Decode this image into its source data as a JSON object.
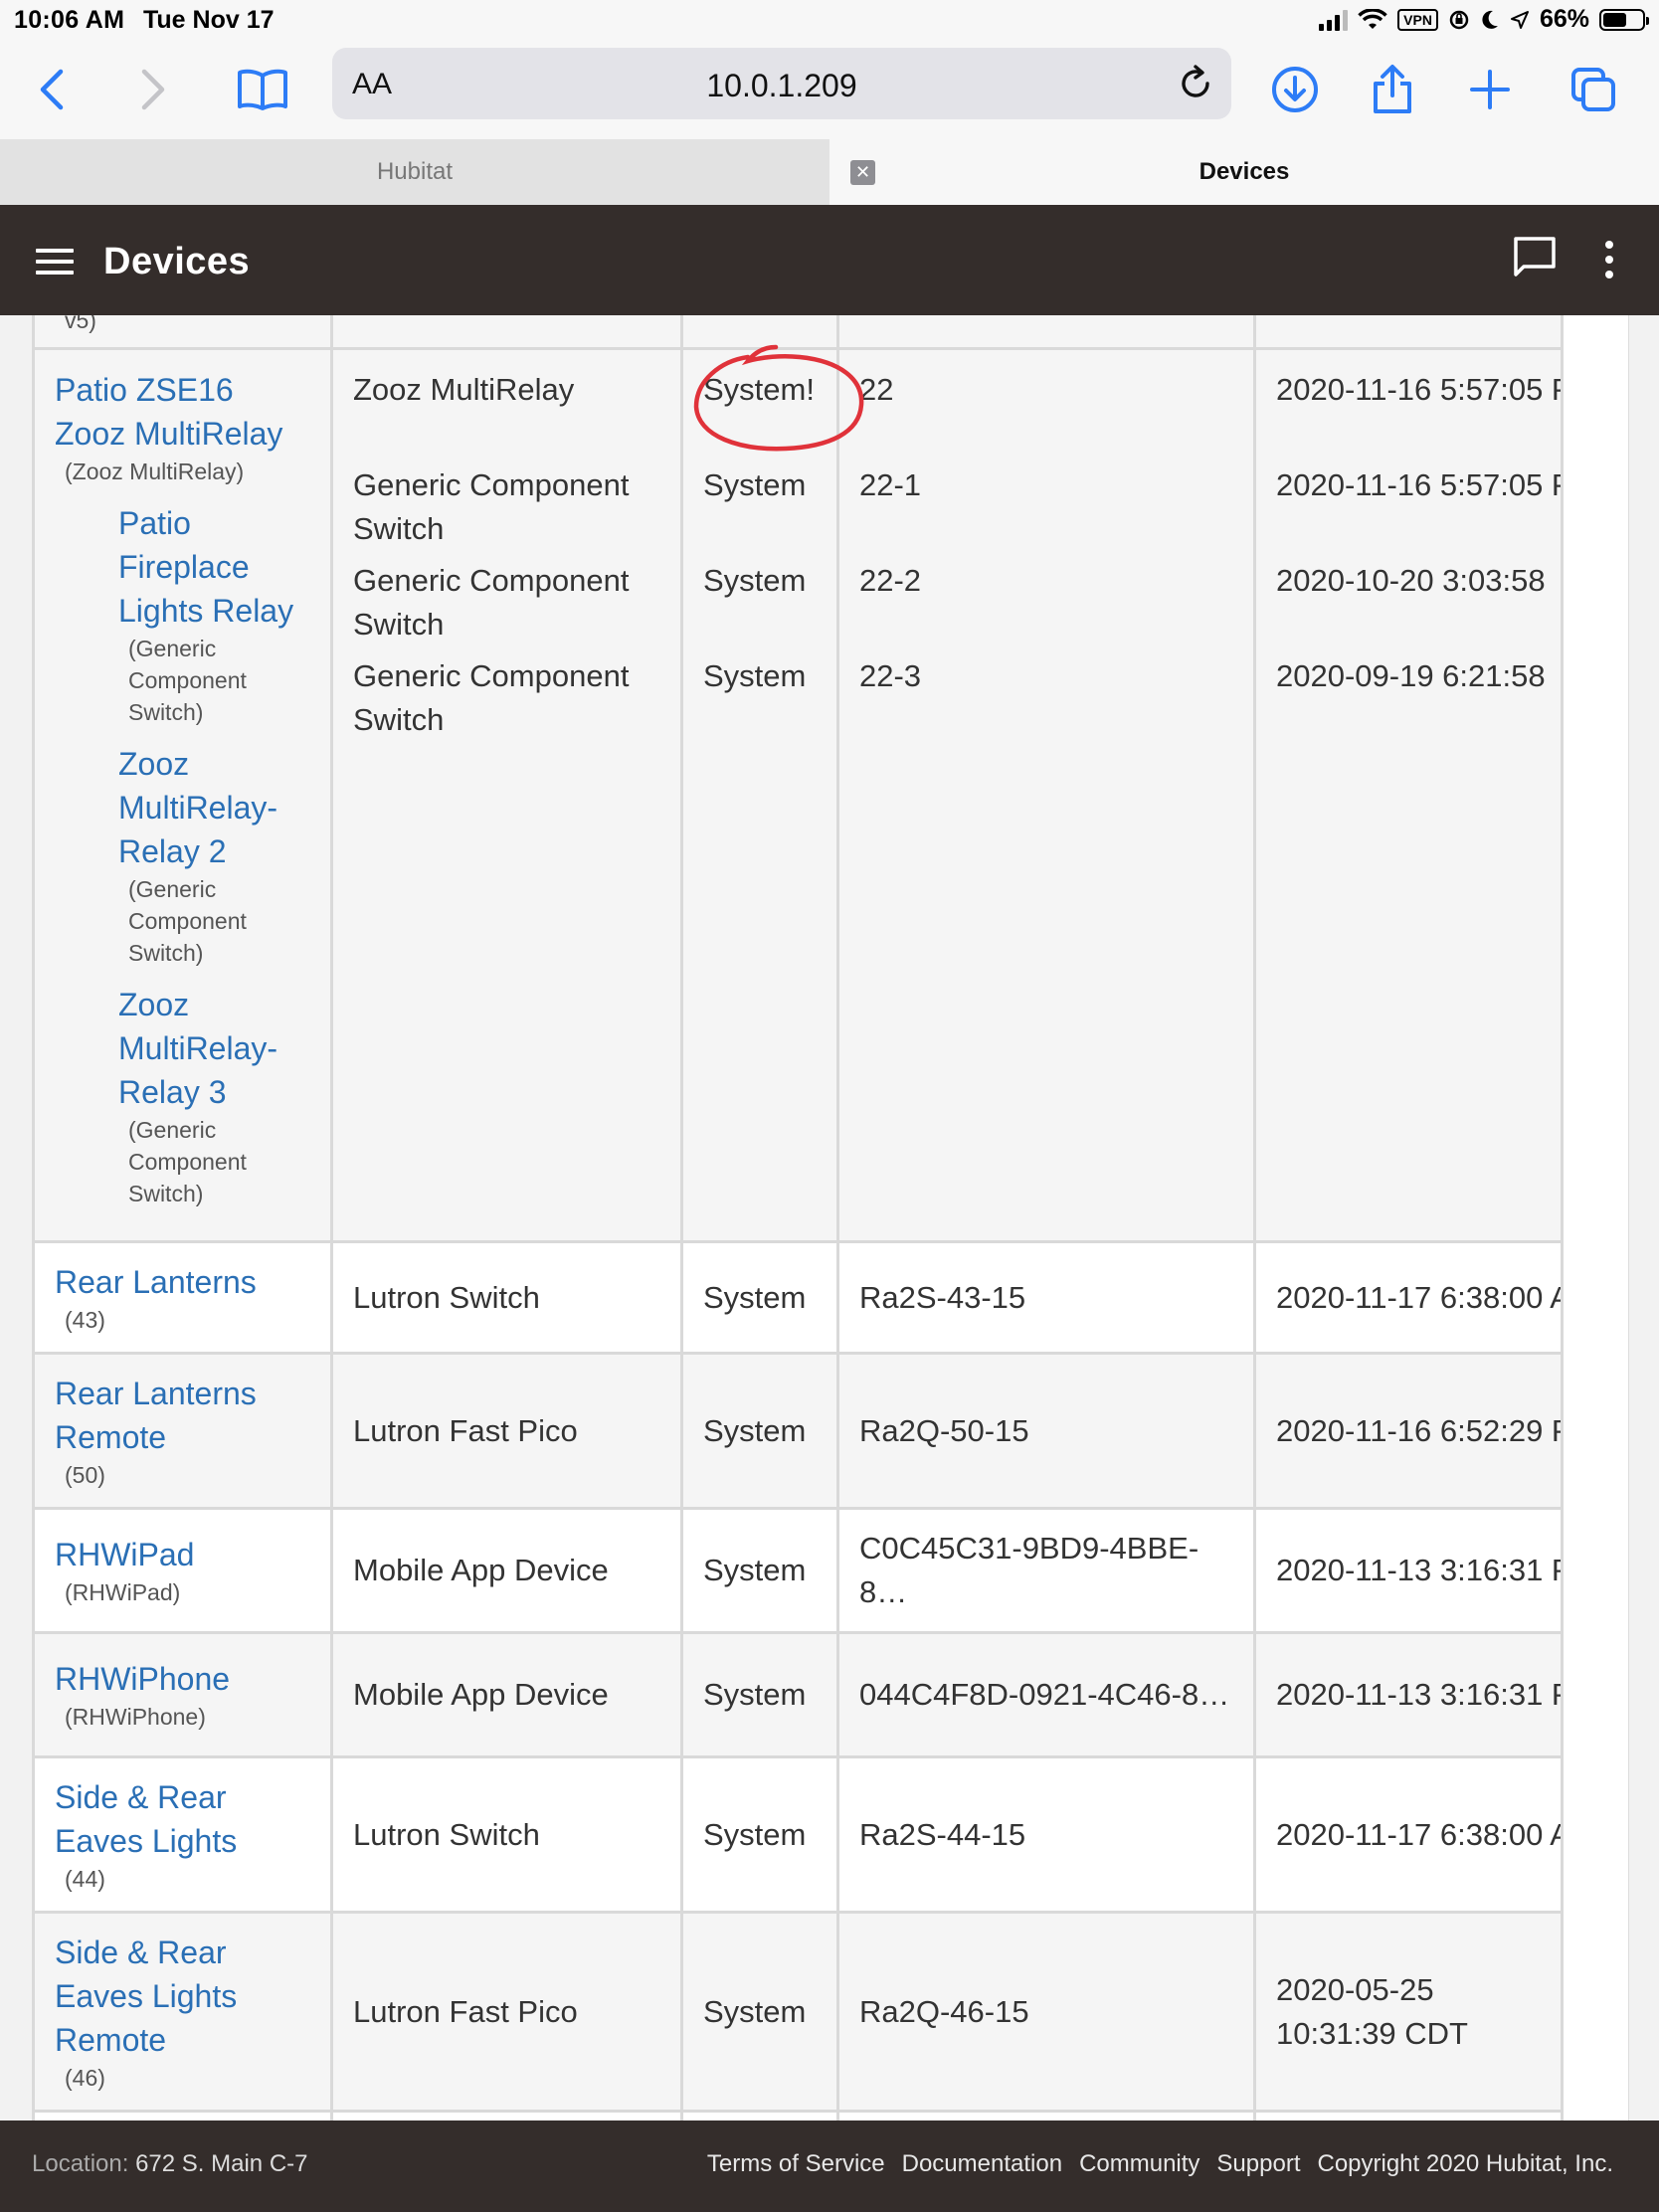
{
  "status_bar": {
    "time": "10:06 AM",
    "date": "Tue Nov 17",
    "vpn": "VPN",
    "battery": "66%"
  },
  "browser": {
    "aa_label": "AA",
    "url": "10.0.1.209",
    "tabs": [
      {
        "label": "Hubitat"
      },
      {
        "label": "Devices"
      }
    ]
  },
  "header": {
    "title": "Devices"
  },
  "devices": [
    {
      "name": "Patio ZSE16 Zooz MultiRelay",
      "type_label": "(Zooz MultiRelay)",
      "driver": "Zooz MultiRelay",
      "source": "System!",
      "dni": "22",
      "last_activity": "2020-11-16 5:57:05 P",
      "children": [
        {
          "name": "Patio Fireplace Lights Relay",
          "type_label": "(Generic Component Switch)",
          "driver": "Generic Component Switch",
          "source": "System",
          "dni": "22-1",
          "last_activity": "2020-11-16 5:57:05 P"
        },
        {
          "name": "Zooz MultiRelay-Relay 2",
          "type_label": "(Generic Component Switch)",
          "driver": "Generic Component Switch",
          "source": "System",
          "dni": "22-2",
          "last_activity": "2020-10-20 3:03:58"
        },
        {
          "name": "Zooz MultiRelay-Relay 3",
          "type_label": "(Generic Component Switch)",
          "driver": "Generic Component Switch",
          "source": "System",
          "dni": "22-3",
          "last_activity": "2020-09-19 6:21:58"
        }
      ]
    },
    {
      "name": "Rear Lanterns",
      "type_label": "(43)",
      "driver": "Lutron Switch",
      "source": "System",
      "dni": "Ra2S-43-15",
      "last_activity": "2020-11-17 6:38:00 A"
    },
    {
      "name": "Rear Lanterns Remote",
      "type_label": "(50)",
      "driver": "Lutron Fast Pico",
      "source": "System",
      "dni": "Ra2Q-50-15",
      "last_activity": "2020-11-16 6:52:29 P"
    },
    {
      "name": "RHWiPad",
      "type_label": "(RHWiPad)",
      "driver": "Mobile App Device",
      "source": "System",
      "dni": "C0C45C31-9BD9-4BBE-8…",
      "last_activity": "2020-11-13 3:16:31 P"
    },
    {
      "name": "RHWiPhone",
      "type_label": "(RHWiPhone)",
      "driver": "Mobile App Device",
      "source": "System",
      "dni": "044C4F8D-0921-4C46-8…",
      "last_activity": "2020-11-13 3:16:31 P"
    },
    {
      "name": "Side & Rear Eaves Lights",
      "type_label": "(44)",
      "driver": "Lutron Switch",
      "source": "System",
      "dni": "Ra2S-44-15",
      "last_activity": "2020-11-17 6:38:00 A"
    },
    {
      "name": "Side & Rear Eaves Lights Remote",
      "type_label": "(46)",
      "driver": "Lutron Fast Pico",
      "source": "System",
      "dni": "Ra2Q-46-15",
      "last_activity": "2020-05-25 10:31:39 CDT"
    }
  ],
  "partial_row_text": "v5)",
  "footer": {
    "location_label": "Location:",
    "location_value": "672 S. Main C-7",
    "links": [
      "Terms of Service",
      "Documentation",
      "Community",
      "Support",
      "Copyright 2020 Hubitat, Inc."
    ]
  },
  "colors": {
    "header_bg": "#342d2b",
    "link": "#2a6fb5",
    "annotation": "#e0323a"
  }
}
